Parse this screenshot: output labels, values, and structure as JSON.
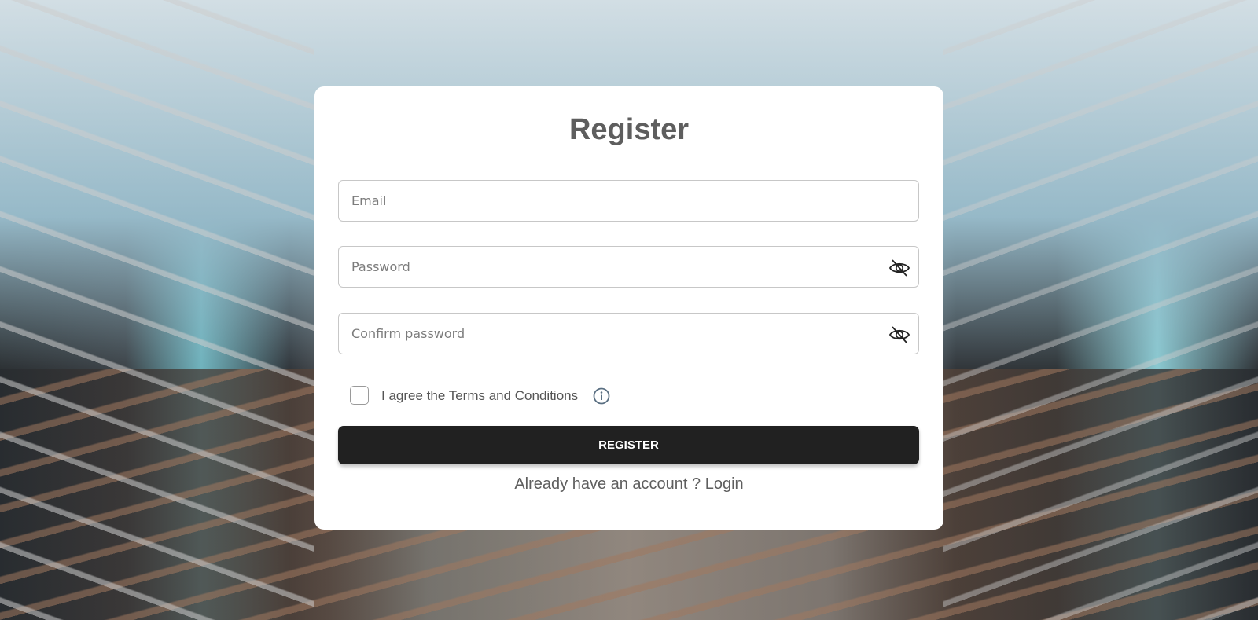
{
  "form": {
    "title": "Register",
    "email": {
      "placeholder": "Email",
      "value": ""
    },
    "password": {
      "placeholder": "Password",
      "value": "",
      "toggle_icon": "eye-off-icon"
    },
    "confirm_password": {
      "placeholder": "Confirm password",
      "value": "",
      "toggle_icon": "eye-off-icon"
    },
    "terms": {
      "label": "I agree the Terms and Conditions",
      "checked": false,
      "info_icon": "info-icon"
    },
    "submit_label": "REGISTER",
    "login_prompt": "Already have an account ?",
    "login_link": "Login"
  },
  "colors": {
    "card_background": "#ffffff",
    "button_background": "#212121",
    "button_text": "#ffffff",
    "title_text": "#5e5e5e"
  }
}
